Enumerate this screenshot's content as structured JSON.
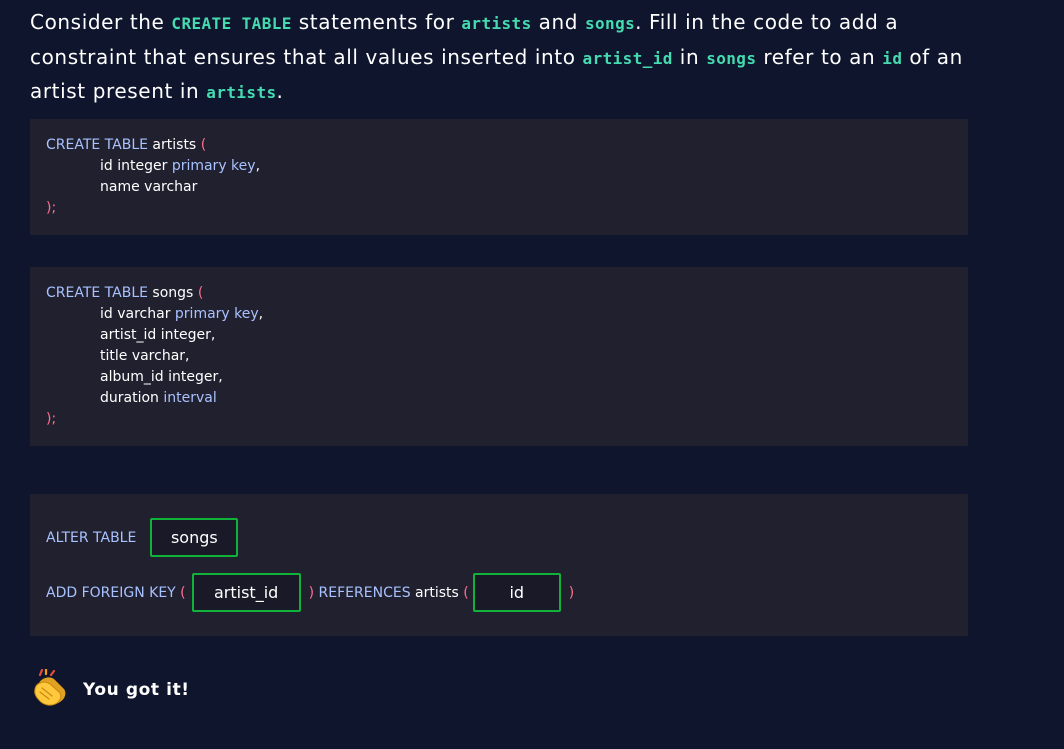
{
  "prompt": {
    "t1": "Consider the ",
    "k1": "CREATE TABLE",
    "t2": " statements for ",
    "k2": "artists",
    "t3": " and ",
    "k3": "songs",
    "t4": ". Fill in the code to add a constraint that ensures that all values inserted into ",
    "k4": "artist_id",
    "t5": " in ",
    "k5": "songs",
    "t6": " refer to an ",
    "k6": "id",
    "t7": " of an artist present in ",
    "k7": "artists",
    "t8": "."
  },
  "block1": {
    "l1_kw": "CREATE TABLE",
    "l1_name": " artists ",
    "l1_paren": "(",
    "l2_a": "id integer ",
    "l2_kw": "primary key",
    "l2_b": ",",
    "l3": "name varchar",
    "l4": ");"
  },
  "block2": {
    "l1_kw": "CREATE TABLE",
    "l1_name": " songs ",
    "l1_paren": "(",
    "l2_a": "id varchar ",
    "l2_kw": "primary key",
    "l2_b": ",",
    "l3": "artist_id integer,",
    "l4": "title varchar,",
    "l5": "album_id integer,",
    "l6_a": "duration ",
    "l6_kw": "interval",
    "l7": ");"
  },
  "block3": {
    "alter_kw": "ALTER TABLE",
    "answer_table": "songs",
    "add_kw": "ADD FOREIGN KEY",
    "open_paren_1": " (",
    "answer_column": "artist_id",
    "close_paren_1": ")",
    "references_kw": " REFERENCES",
    "references_table": " artists ",
    "open_paren_2": "(",
    "answer_ref_column": "id",
    "close_paren_2": ")"
  },
  "feedback": {
    "icon": "clapping-hands-icon",
    "text": "You got it!"
  },
  "colors": {
    "background": "#0f152c",
    "code_background": "#21202f",
    "keyword_teal": "#44dbb1",
    "sql_keyword": "#a8c2ff",
    "paren": "#ff6f8b",
    "answer_border": "#11b23a"
  }
}
